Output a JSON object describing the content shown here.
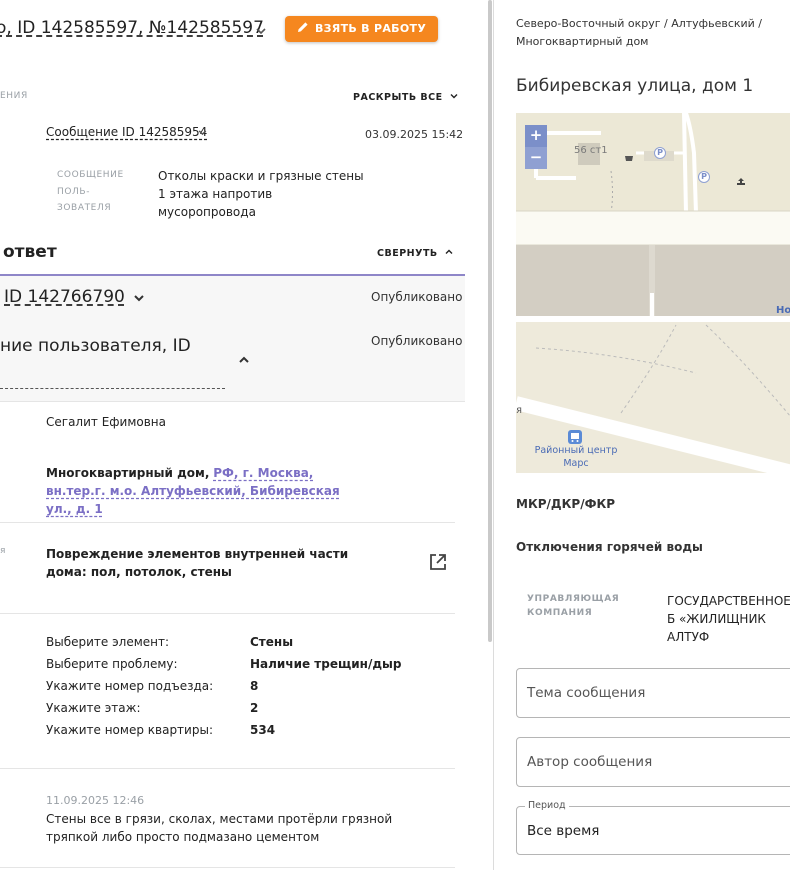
{
  "header": {
    "title": "о, ID 142585597, №142585597",
    "take_button": "ВЗЯТЬ В РАБОТУ"
  },
  "messages_section": {
    "label": "ЕНИЯ",
    "expand_all": "РАСКРЫТЬ ВСЕ",
    "message_link": "Сообщение ID 142585954",
    "message_date": "03.09.2025 15:42",
    "user_message_label": "СООБЩЕНИЕ ПОЛЬ- ЗОВАТЕЛЯ",
    "user_message_text": "Отколы краски и грязные стены 1 этажа напротив мусоропровода"
  },
  "answer_section": {
    "title": "ответ",
    "collapse": "СВЕРНУТЬ",
    "answer_id": "ID 142766790",
    "answer_status": "Опубликовано",
    "user_msg_title": "ние пользователя, ID",
    "user_msg_status": "Опубликовано",
    "author": "Сегалит Ефимовна",
    "address_type": "Многоквартирный дом,",
    "address_link": "РФ, г. Москва, вн.тер.г. м.о. Алтуфьевский, Бибиревская ул., д. 1",
    "category_label": "я",
    "category_text": "Повреждение элементов внутренней части дома: пол, потолок, стены"
  },
  "details": [
    {
      "label": "Выберите элемент:",
      "value": "Стены"
    },
    {
      "label": "Выберите проблему:",
      "value": "Наличие трещин/дыр"
    },
    {
      "label": "Укажите номер подъезда:",
      "value": "8"
    },
    {
      "label": "Укажите этаж:",
      "value": "2"
    },
    {
      "label": "Укажите номер квартиры:",
      "value": "534"
    }
  ],
  "comment": {
    "date": "11.09.2025 12:46",
    "text": "Стены все в грязи, сколах, местами протёрли грязной тряпкой либо просто подмазано цементом"
  },
  "right_panel": {
    "breadcrumb": "Северо-Восточный округ / Алтуфьевский / Многоквартирный дом",
    "address_title": "Бибиревская улица, дом 1",
    "map": {
      "zoom_in": "+",
      "zoom_out": "−",
      "building_label": "56 ст1",
      "parking": "P",
      "bus_stop_label": "Районный центр Марс",
      "road_label_partial": "Но",
      "side_label": "я"
    },
    "mkr_label": "МКР/ДКР/ФКР",
    "hot_water_label": "Отключения горячей воды",
    "management_label": "УПРАВЛЯЮЩАЯ КОМПАНИЯ",
    "management_value": "ГОСУДАРСТВЕННОЕ Б «ЖИЛИЩНИК АЛТУФ",
    "subject_placeholder": "Тема сообщения",
    "author_placeholder": "Автор сообщения",
    "period_label": "Период",
    "period_value": "Все время"
  },
  "colors": {
    "accent_orange": "#f5871f",
    "link_purple": "#7b6fc5",
    "divider_purple": "#8e86c8"
  }
}
